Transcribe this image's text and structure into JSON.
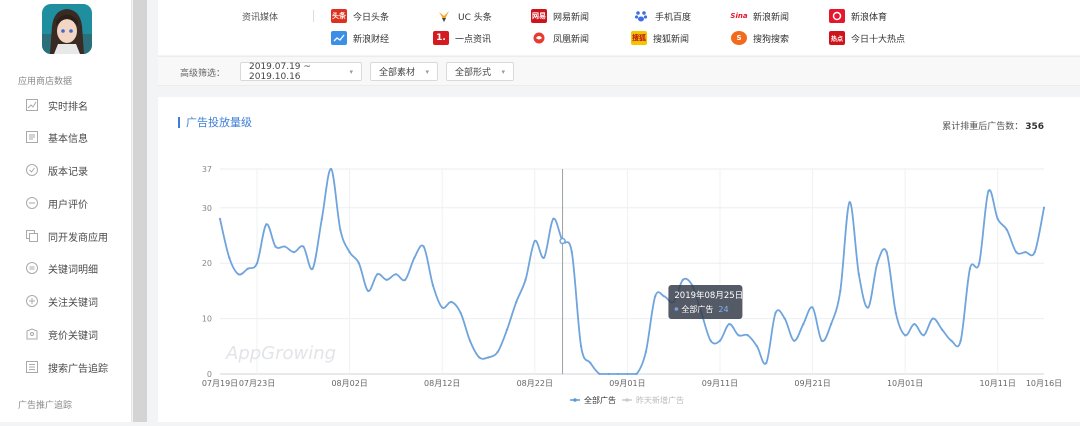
{
  "sidebar": {
    "section_top": "应用商店数据",
    "items": [
      {
        "label": "实时排名",
        "icon": "chart-icon"
      },
      {
        "label": "基本信息",
        "icon": "info-icon"
      },
      {
        "label": "版本记录",
        "icon": "check-circle-icon"
      },
      {
        "label": "用户评价",
        "icon": "comment-icon"
      },
      {
        "label": "同开发商应用",
        "icon": "copy-icon"
      },
      {
        "label": "关键词明细",
        "icon": "list-icon"
      },
      {
        "label": "关注关键词",
        "icon": "plus-circle-icon"
      },
      {
        "label": "竞价关键词",
        "icon": "tag-icon"
      },
      {
        "label": "搜索广告追踪",
        "icon": "document-icon"
      }
    ],
    "section_bottom": "广告推广追踪"
  },
  "media": {
    "label": "资讯媒体",
    "items": [
      {
        "label": "今日头条",
        "logo_text": "头条",
        "color": "#e0301e"
      },
      {
        "label": "UC 头条",
        "logo_text": "",
        "color": "#f5a623"
      },
      {
        "label": "网易新闻",
        "logo_text": "网易",
        "color": "#d0121b"
      },
      {
        "label": "手机百度",
        "logo_text": "",
        "color": "#3f6fe3"
      },
      {
        "label": "新浪新闻",
        "logo_text": "Sina",
        "color": "#e6162d"
      },
      {
        "label": "新浪体育",
        "logo_text": "",
        "color": "#e6162d"
      },
      {
        "label": "新浪财经",
        "logo_text": "",
        "color": "#3b8fe6"
      },
      {
        "label": "一点资讯",
        "logo_text": "1.",
        "color": "#d51b22"
      },
      {
        "label": "凤凰新闻",
        "logo_text": "",
        "color": "#e53c2f"
      },
      {
        "label": "搜狐新闻",
        "logo_text": "搜狐",
        "color": "#f2c600"
      },
      {
        "label": "搜狗搜索",
        "logo_text": "S",
        "color": "#f26b1d"
      },
      {
        "label": "今日十大热点",
        "logo_text": "热点",
        "color": "#d0121b"
      }
    ]
  },
  "filters": {
    "label": "高级筛选：",
    "date_range": "2019.07.19 ~ 2019.10.16",
    "material": "全部素材",
    "format": "全部形式"
  },
  "panel": {
    "title": "广告投放量级",
    "stat_label": "累计排重后广告数：",
    "stat_value": "356"
  },
  "tooltip": {
    "date": "2019年08月25日",
    "series": "全部广告",
    "value": "24"
  },
  "watermark": "AppGrowing",
  "chart_data": {
    "type": "line",
    "ylim": [
      0,
      37
    ],
    "yticks": [
      0,
      10,
      20,
      30,
      37
    ],
    "xticks": [
      "07月19日",
      "07月23日",
      "08月02日",
      "08月12日",
      "08月22日",
      "09月01日",
      "09月11日",
      "09月21日",
      "10月01日",
      "10月11日",
      "10月16日"
    ],
    "legend": [
      {
        "name": "全部广告",
        "color": "#5b9bd5"
      },
      {
        "name": "昨天新增广告",
        "color": "#c8ccd2"
      }
    ],
    "series": [
      {
        "name": "全部广告",
        "x": [
          "07-19",
          "07-20",
          "07-21",
          "07-22",
          "07-23",
          "07-24",
          "07-25",
          "07-26",
          "07-27",
          "07-28",
          "07-29",
          "07-30",
          "07-31",
          "08-01",
          "08-02",
          "08-03",
          "08-04",
          "08-05",
          "08-06",
          "08-07",
          "08-08",
          "08-09",
          "08-10",
          "08-11",
          "08-12",
          "08-13",
          "08-14",
          "08-15",
          "08-16",
          "08-17",
          "08-18",
          "08-19",
          "08-20",
          "08-21",
          "08-22",
          "08-23",
          "08-24",
          "08-25",
          "08-26",
          "08-27",
          "08-28",
          "08-29",
          "08-30",
          "08-31",
          "09-01",
          "09-02",
          "09-03",
          "09-04",
          "09-05",
          "09-06",
          "09-07",
          "09-08",
          "09-09",
          "09-10",
          "09-11",
          "09-12",
          "09-13",
          "09-14",
          "09-15",
          "09-16",
          "09-17",
          "09-18",
          "09-19",
          "09-20",
          "09-21",
          "09-22",
          "09-23",
          "09-24",
          "09-25",
          "09-26",
          "09-27",
          "09-28",
          "09-29",
          "09-30",
          "10-01",
          "10-02",
          "10-03",
          "10-04",
          "10-05",
          "10-06",
          "10-07",
          "10-08",
          "10-09",
          "10-10",
          "10-11",
          "10-12",
          "10-13",
          "10-14",
          "10-15",
          "10-16"
        ],
        "values": [
          28,
          21,
          18,
          19,
          20,
          27,
          23,
          23,
          22,
          23,
          19,
          28,
          37,
          26,
          22,
          20,
          15,
          18,
          17,
          18,
          17,
          21,
          23,
          16,
          12,
          13,
          11,
          6,
          3,
          3,
          4,
          8,
          13,
          17,
          24,
          21,
          28,
          24,
          22,
          5,
          2,
          0,
          0,
          0,
          0,
          0,
          4,
          14,
          14,
          13,
          17,
          16,
          11,
          6,
          6,
          9,
          7,
          7,
          5,
          2,
          11,
          10,
          6,
          9,
          12,
          6,
          9,
          15,
          31,
          18,
          12,
          20,
          22,
          11,
          7,
          9,
          7,
          10,
          8,
          6,
          6,
          19,
          20,
          33,
          28,
          26,
          22,
          22,
          22,
          30
        ]
      }
    ]
  }
}
